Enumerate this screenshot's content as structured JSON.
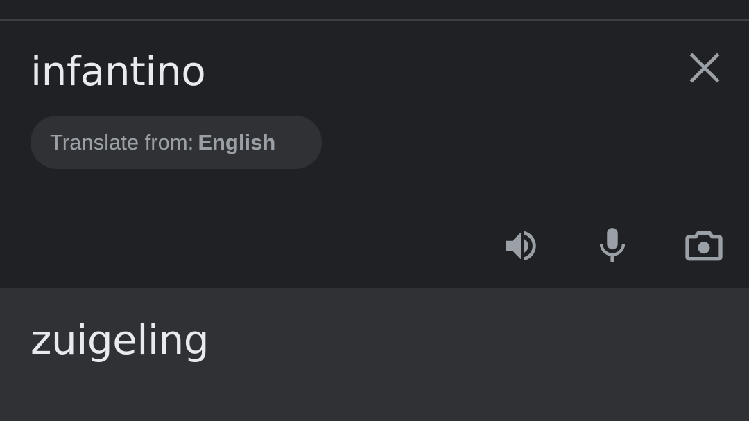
{
  "input": {
    "source_text": "infantino",
    "language_chip": {
      "prefix": "Translate from:",
      "language": "English"
    }
  },
  "output": {
    "result_text": "zuigeling"
  },
  "icons": {
    "close": "close-icon",
    "speaker": "speaker-icon",
    "mic": "microphone-icon",
    "camera": "camera-icon"
  },
  "colors": {
    "background": "#202124",
    "output_background": "#303134",
    "text_primary": "#e8eaed",
    "text_secondary": "#9aa0a6",
    "icon": "#9aa0a6",
    "chip_background": "#303134"
  }
}
